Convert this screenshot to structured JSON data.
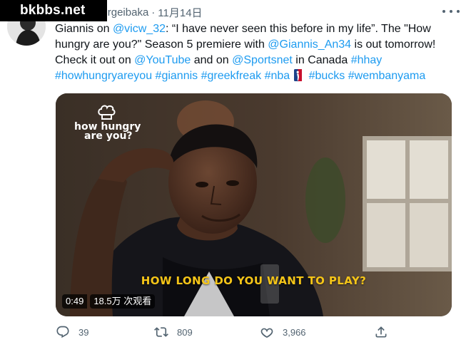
{
  "watermark": "bkbbs.net",
  "header": {
    "display_name": "ka",
    "handle": "@sergeibaka",
    "separator": "·",
    "timestamp": "11月14日"
  },
  "tweet": {
    "p1": "Giannis on ",
    "mention_vicw": "@vicw_32",
    "p2": ": “I have never seen this before in my life”. The \"How hungry are you?\" Season 5 premiere with ",
    "mention_giannis": "@Giannis_An34",
    "p3": " is out tomorrow! Check it out on ",
    "mention_youtube": "@YouTube",
    "p4": " and on ",
    "mention_sportsnet": "@Sportsnet",
    "p5": " in Canada ",
    "hashtag_hhay": "#hhay",
    "hashtag_howhungry": "#howhungryareyou",
    "hashtag_giannis": "#giannis",
    "hashtag_greekfreak": "#greekfreak",
    "hashtag_nba": "#nba",
    "hashtag_bucks": "#bucks",
    "hashtag_wemby": "#wembanyama"
  },
  "media": {
    "brand_line1": "how hungry",
    "brand_line2": "are you?",
    "caption": "HOW LONG DO YOU WANT TO PLAY?",
    "duration": "0:49",
    "views": "18.5万 次观看"
  },
  "actions": {
    "replies": "39",
    "retweets": "809",
    "likes": "3,966"
  },
  "icons": [
    "verified-badge-icon",
    "more-icon",
    "nba-logo-icon",
    "chef-hat-icon",
    "reply-icon",
    "retweet-icon",
    "like-icon",
    "share-icon"
  ],
  "colors": {
    "link": "#1d9bf0",
    "secondary_text": "#536471",
    "verified": "#1d9bf0",
    "caption": "#f5c518"
  }
}
